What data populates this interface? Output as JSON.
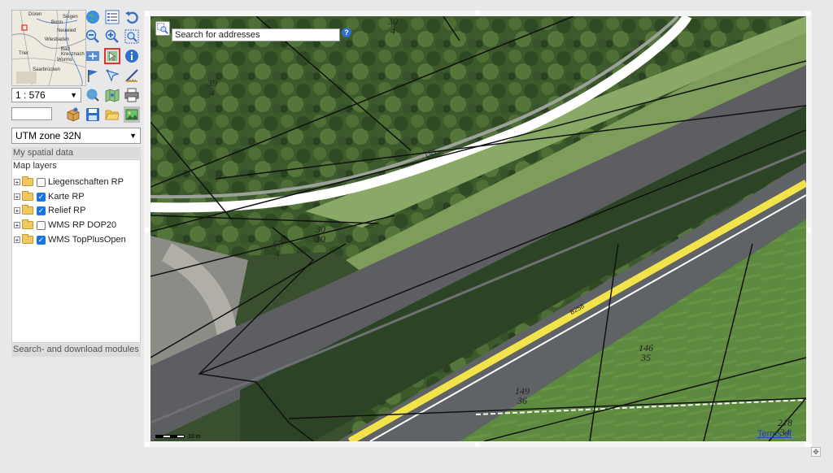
{
  "toolbar": {
    "scale_value": "1 : 576",
    "coordinate_input_value": "",
    "crs_value": "UTM zone 32N",
    "icons": [
      "globe-icon",
      "legend-icon",
      "undo-icon",
      "zoom-out-icon",
      "zoom-in-icon",
      "zoom-extent-icon",
      "pan-icon",
      "select-icon",
      "info-icon",
      "flag-icon",
      "measure-icon",
      "ruler-icon",
      "search-globe-icon",
      "map-icon",
      "print-icon",
      "package-icon",
      "save-icon",
      "open-folder-icon",
      "export-image-icon"
    ]
  },
  "overview": {
    "place_labels": [
      "Düren",
      "Siegen",
      "Bonn",
      "Neuwied",
      "Wiesbaden",
      "Trier",
      "Worms",
      "Saarbrücken",
      "Bad Kreuznach"
    ]
  },
  "panels": {
    "my_spatial_data": "My spatial data",
    "map_layers": "Map layers",
    "search_download": "Search- and download modules"
  },
  "layers": [
    {
      "label": "Liegenschaften RP",
      "checked": false
    },
    {
      "label": "Karte RP",
      "checked": true
    },
    {
      "label": "Relief RP",
      "checked": true
    },
    {
      "label": "WMS RP DOP20",
      "checked": false
    },
    {
      "label": "WMS TopPlusOpen",
      "checked": true
    }
  ],
  "map": {
    "search_placeholder": "Search for addresses",
    "help_symbol": "?",
    "road_labels": {
      "l93": "L93",
      "b258": "B258"
    },
    "parcels": [
      {
        "id": "p1",
        "num": "30",
        "sub": "4"
      },
      {
        "id": "p2",
        "num": "39",
        "sub": "4"
      },
      {
        "id": "p3",
        "num": "30",
        "sub": "10"
      },
      {
        "id": "p4",
        "num": "67",
        "sub": "4"
      },
      {
        "id": "p5",
        "num": "146",
        "sub": "35"
      },
      {
        "id": "p6",
        "num": "149",
        "sub": "36"
      },
      {
        "id": "p7",
        "num": "218",
        "sub": "34"
      }
    ],
    "scale_bar_label": "10 m",
    "terms_link": "Terms of use"
  }
}
